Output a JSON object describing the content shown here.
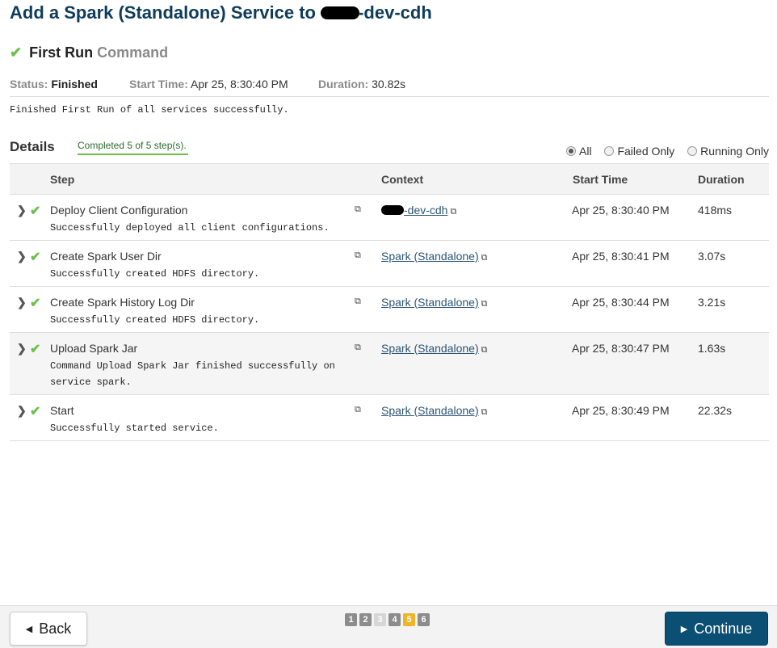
{
  "page": {
    "title_prefix": "Add a Spark (Standalone) Service to ",
    "title_suffix": "-dev-cdh"
  },
  "command": {
    "name": "First Run",
    "suffix": "Command",
    "status_label": "Status:",
    "status_value": "Finished",
    "start_label": "Start Time:",
    "start_value": "Apr 25, 8:30:40 PM",
    "duration_label": "Duration:",
    "duration_value": "30.82s",
    "result_message": "Finished First Run of all services successfully."
  },
  "details": {
    "title": "Details",
    "progress": "Completed 5 of 5 step(s).",
    "filters": [
      {
        "label": "All",
        "selected": true
      },
      {
        "label": "Failed Only",
        "selected": false
      },
      {
        "label": "Running Only",
        "selected": false
      }
    ],
    "columns": {
      "step": "Step",
      "context": "Context",
      "start_time": "Start Time",
      "duration": "Duration"
    },
    "rows": [
      {
        "name": "Deploy Client Configuration",
        "message": "Successfully deployed all client configurations.",
        "context": "-dev-cdh",
        "start": "Apr 25, 8:30:40 PM",
        "duration": "418ms"
      },
      {
        "name": "Create Spark User Dir",
        "message": "Successfully created HDFS directory.",
        "context": "Spark (Standalone)",
        "start": "Apr 25, 8:30:41 PM",
        "duration": "3.07s"
      },
      {
        "name": "Create Spark History Log Dir",
        "message": "Successfully created HDFS directory.",
        "context": "Spark (Standalone)",
        "start": "Apr 25, 8:30:44 PM",
        "duration": "3.21s"
      },
      {
        "name": "Upload Spark Jar",
        "message": "Command Upload Spark Jar finished successfully on service spark.",
        "context": "Spark (Standalone)",
        "start": "Apr 25, 8:30:47 PM",
        "duration": "1.63s"
      },
      {
        "name": "Start",
        "message": "Successfully started service.",
        "context": "Spark (Standalone)",
        "start": "Apr 25, 8:30:49 PM",
        "duration": "22.32s"
      }
    ]
  },
  "footer": {
    "back_label": "Back",
    "continue_label": "Continue",
    "pages": [
      {
        "label": "1",
        "state": "done",
        "color": "#8c8c8c"
      },
      {
        "label": "2",
        "state": "done",
        "color": "#8c8c8c"
      },
      {
        "label": "3",
        "state": "skipped",
        "color": "#d6d6d6"
      },
      {
        "label": "4",
        "state": "done",
        "color": "#8c8c8c"
      },
      {
        "label": "5",
        "state": "current",
        "color": "#f0b429"
      },
      {
        "label": "6",
        "state": "done",
        "color": "#8c8c8c"
      }
    ]
  },
  "icons": {
    "check": "check-icon",
    "expand": "chevron-right-icon",
    "external": "external-link-icon",
    "back": "skip-back-icon",
    "continue": "skip-forward-icon"
  },
  "colors": {
    "title": "#0e3c5a",
    "success": "#6cc04a",
    "primary_button": "#0b4f74",
    "link": "#2b5573",
    "current_step": "#f0b429"
  }
}
